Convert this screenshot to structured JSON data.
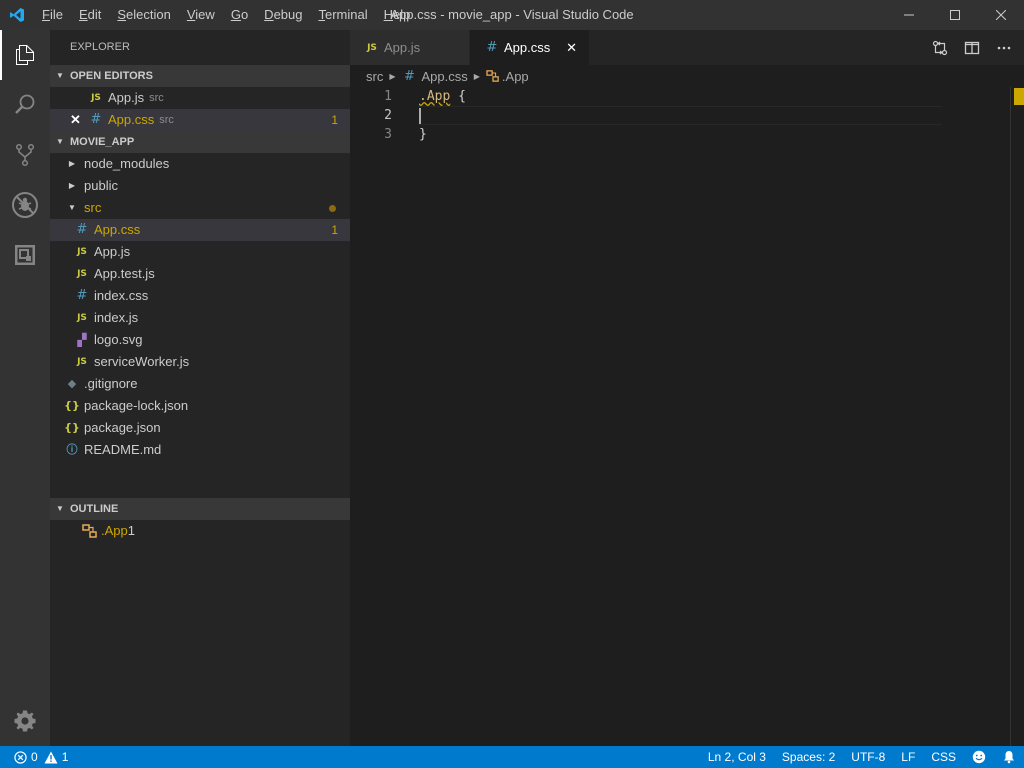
{
  "window": {
    "title": "App.css - movie_app - Visual Studio Code",
    "menu": [
      "File",
      "Edit",
      "Selection",
      "View",
      "Go",
      "Debug",
      "Terminal",
      "Help"
    ],
    "menu_underline": [
      "F",
      "E",
      "S",
      "V",
      "G",
      "D",
      "T",
      "H"
    ]
  },
  "activity_bar": {
    "items": [
      "files-icon",
      "search-icon",
      "source-control-icon",
      "debug-icon",
      "extensions-icon"
    ],
    "bottom": "gear-icon"
  },
  "sidebar": {
    "title": "EXPLORER",
    "open_editors": {
      "header": "OPEN EDITORS",
      "items": [
        {
          "name": "App.js",
          "folder": "src",
          "type": "js",
          "badge": ""
        },
        {
          "name": "App.css",
          "folder": "src",
          "type": "css",
          "badge": "1"
        }
      ]
    },
    "project": {
      "header": "MOVIE_APP",
      "folders": [
        {
          "name": "node_modules"
        },
        {
          "name": "public"
        },
        {
          "name": "src"
        }
      ],
      "src_files": [
        {
          "name": "App.css",
          "type": "css",
          "badge": "1"
        },
        {
          "name": "App.js",
          "type": "js"
        },
        {
          "name": "App.test.js",
          "type": "js"
        },
        {
          "name": "index.css",
          "type": "css"
        },
        {
          "name": "index.js",
          "type": "js"
        },
        {
          "name": "logo.svg",
          "type": "svg"
        },
        {
          "name": "serviceWorker.js",
          "type": "js"
        }
      ],
      "root_files": [
        {
          "name": ".gitignore",
          "type": "git"
        },
        {
          "name": "package-lock.json",
          "type": "json"
        },
        {
          "name": "package.json",
          "type": "json"
        },
        {
          "name": "README.md",
          "type": "info"
        }
      ]
    },
    "outline": {
      "header": "OUTLINE",
      "items": [
        {
          "name": ".App",
          "badge": "1"
        }
      ]
    }
  },
  "icons": {
    "js": "JS",
    "css": "#",
    "json": "{}",
    "info": "ⓘ",
    "git": "◆",
    "svg": "▞"
  },
  "tabs": [
    {
      "label": "App.js",
      "type": "js",
      "active": false
    },
    {
      "label": "App.css",
      "type": "css",
      "active": true,
      "close": "✕"
    }
  ],
  "breadcrumbs": {
    "folder": "src",
    "file": "App.css",
    "symbol": ".App"
  },
  "editor": {
    "lines": [
      {
        "number": "1",
        "selector": ".App",
        "rest": " {"
      },
      {
        "number": "2",
        "text": ""
      },
      {
        "number": "3",
        "text": "}"
      }
    ]
  },
  "status_bar": {
    "errors": "0",
    "warnings": "1",
    "position": "Ln 2, Col 3",
    "spaces": "Spaces: 2",
    "encoding": "UTF-8",
    "eol": "LF",
    "language": "CSS"
  },
  "colors": {
    "accent": "#007acc",
    "warning": "#cca700",
    "js_icon": "#cbcb41",
    "css_icon": "#519aba"
  }
}
